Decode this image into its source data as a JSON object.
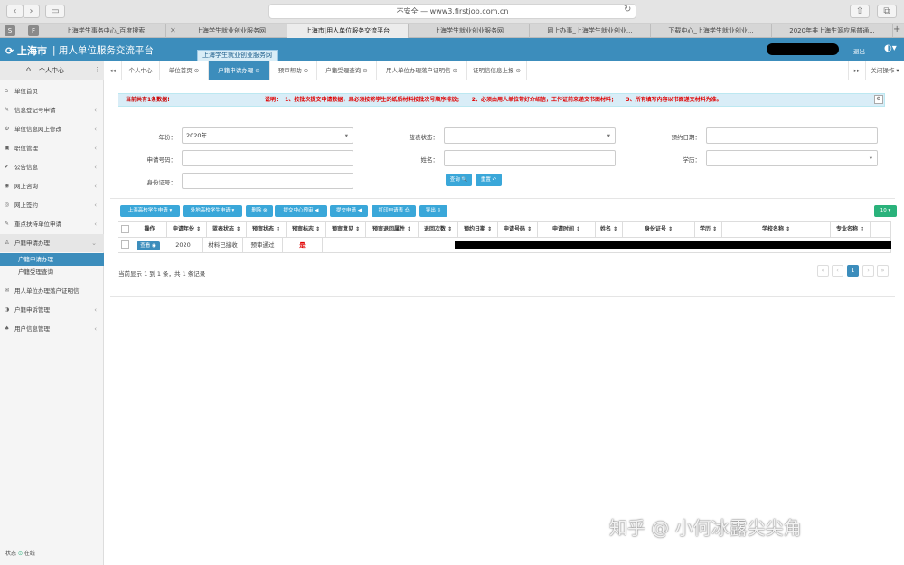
{
  "browser": {
    "url": "不安全 — www3.firstjob.com.cn",
    "tabs": [
      "上海学生事务中心_百度搜索",
      "上海学生就业创业服务网",
      "上海市|用人单位服务交流平台",
      "上海学生就业创业服务网",
      "网上办事_上海学生就业创业...",
      "下载中心_上海学生就业创业...",
      "2020年非上海生源应届普通..."
    ],
    "side_tab_s": "S",
    "side_tab_f": "F"
  },
  "header": {
    "brand": "上海市",
    "title": "用人单位服务交流平台",
    "tooltip": "上海学生就业创业服务网",
    "exit": "退出"
  },
  "sidebar": {
    "personal_center": "个人中心",
    "items": [
      {
        "label": "单位首页",
        "icon": "home-icon",
        "glyph": "⌂",
        "chev": ""
      },
      {
        "label": "信息登记号申请",
        "icon": "edit-icon",
        "glyph": "✎",
        "chev": "‹"
      },
      {
        "label": "单位信息网上修改",
        "icon": "gear-icon",
        "glyph": "⚙",
        "chev": "‹"
      },
      {
        "label": "职位管理",
        "icon": "briefcase-icon",
        "glyph": "▣",
        "chev": "‹"
      },
      {
        "label": "公告信息",
        "icon": "check-icon",
        "glyph": "✔",
        "chev": "‹"
      },
      {
        "label": "网上咨询",
        "icon": "chat-icon",
        "glyph": "◉",
        "chev": "‹"
      },
      {
        "label": "网上签约",
        "icon": "eye-icon",
        "glyph": "◎",
        "chev": "‹"
      },
      {
        "label": "重点扶持单位申请",
        "icon": "pencil-icon",
        "glyph": "✎",
        "chev": "‹"
      },
      {
        "label": "户籍申请办理",
        "icon": "user-icon",
        "glyph": "♙",
        "chev": "⌄"
      }
    ],
    "subitems": [
      "户籍申请办理",
      "户籍受理查询"
    ],
    "items2": [
      {
        "label": "用人单位办理落户证明信",
        "icon": "mail-icon",
        "glyph": "✉",
        "chev": ""
      },
      {
        "label": "户籍申诉管理",
        "icon": "contrast-icon",
        "glyph": "◑",
        "chev": "‹"
      },
      {
        "label": "用户信息管理",
        "icon": "bell-icon",
        "glyph": "♠",
        "chev": "‹"
      }
    ],
    "status_label": "状态",
    "status_value": "在线"
  },
  "pagetabs": {
    "back": "◂◂",
    "items": [
      "个人中心",
      "单位首页 ⊙",
      "户籍申请办理 ⊙",
      "预审帮助 ⊙",
      "户籍受理查询 ⊙",
      "用人单位办理落户证明信 ⊙",
      "证明信信息上报 ⊙"
    ],
    "forward": "▸▸",
    "close_ops": "关闭操作 ▾"
  },
  "notice": {
    "count": "当前共有1条数据!",
    "desc": "说明：  1、按批次提交申请数据，且必须按将学生的纸质材料按批次号顺序排放；     2、必须由用人单位带好介绍信，工作证前来递交书面材料；     3、所有填写内容以书面递交材料为准。"
  },
  "form": {
    "year_label": "年份：",
    "year_value": "2020年",
    "table_status_label": "蓝表状态：",
    "appt_date_label": "预约日期：",
    "app_no_label": "申请号码：",
    "name_label": "姓名：",
    "edu_label": "学历：",
    "id_label": "身份证号：",
    "query_btn": "查询 🔍",
    "reset_btn": "重置 ↶"
  },
  "toolbar": {
    "btn_local": "上海高校学生申请 ▾",
    "btn_external": "外地高校学生申请 ▾",
    "btn_delete": "删除 ⊗",
    "btn_submit_center": "提交中心预审 ◀",
    "btn_submit": "提交申请 ◀",
    "btn_print": "打印申请表 ⎙",
    "btn_export": "导出 ⇩",
    "page_size": "10 ▾"
  },
  "table": {
    "headers": [
      "操作",
      "申请年份 ⇕",
      "蓝表状态 ⇕",
      "预审状态 ⇕",
      "预审标志 ⇕",
      "预审意见 ⇕",
      "预审退回属性 ⇕",
      "退回次数 ⇕",
      "预约日期 ⇕",
      "申请号码 ⇕",
      "申请时间 ⇕",
      "姓名 ⇕",
      "身份证号 ⇕",
      "学历 ⇕",
      "学校名称 ⇕",
      "专业名称 ⇕"
    ],
    "row": {
      "view_btn": "查看 ◉",
      "year": "2020",
      "table_status": "材料已接收",
      "precheck_status": "预审通过",
      "precheck_flag": "是"
    }
  },
  "pagination": {
    "info": "当前显示 1 到 1 条，共 1 条记录",
    "first": "«",
    "prev": "‹",
    "current": "1",
    "next": "›",
    "last": "»"
  },
  "watermark": "知乎 @ 小何冰露尖尖角",
  "colors": {
    "primary": "#3c8dbc",
    "button": "#3aa7d9",
    "green": "#2ab27b",
    "warn": "#e00000"
  }
}
